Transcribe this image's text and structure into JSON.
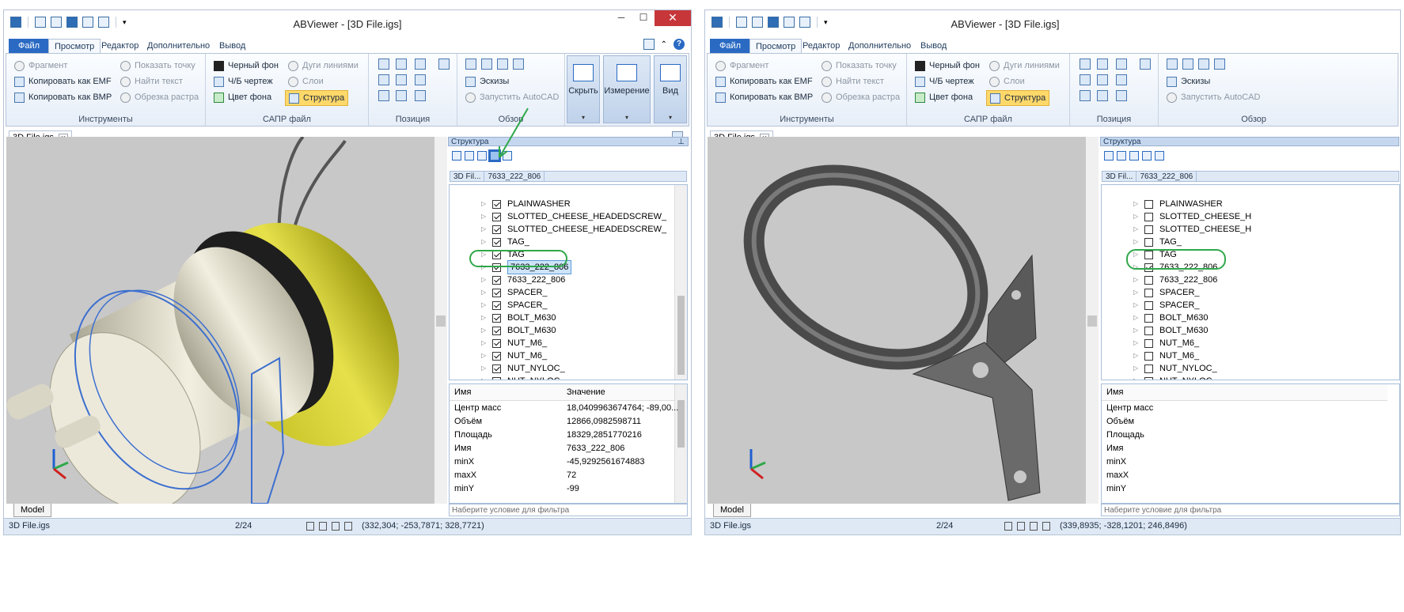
{
  "windows": [
    {
      "title": "ABViewer - [3D File.igs]",
      "tabs": {
        "file": "Файл",
        "view": "Просмотр",
        "editor": "Редактор",
        "advanced": "Дополнительно",
        "output": "Вывод"
      },
      "ribbon": {
        "tools": {
          "title": "Инструменты",
          "fragment": "Фрагмент",
          "copy_emf": "Копировать как EMF",
          "copy_bmp": "Копировать как BMP",
          "show_point": "Показать точку",
          "find_text": "Найти текст",
          "crop_raster": "Обрезка растра"
        },
        "cad": {
          "title": "САПР файл",
          "black_bg": "Черный фон",
          "bw_drawing": "Ч/Б чертеж",
          "bg_color": "Цвет фона",
          "arcs_lines": "Дуги линиями",
          "layers": "Слои",
          "structure": "Структура"
        },
        "position": {
          "title": "Позиция"
        },
        "overview": {
          "title": "Обзор",
          "sketches": "Эскизы",
          "run_autocad": "Запустить AutoCAD"
        },
        "hide": "Скрыть",
        "measure": "Измерение",
        "view": "Вид"
      },
      "doc_tab": "3D File.igs",
      "panel": {
        "header": "Структура",
        "breadcrumb": [
          "3D Fil...",
          "7633_222_806"
        ],
        "tree": [
          {
            "label": "PLAINWASHER",
            "checked": true
          },
          {
            "label": "SLOTTED_CHEESE_HEADEDSCREW_",
            "checked": true
          },
          {
            "label": "SLOTTED_CHEESE_HEADEDSCREW_",
            "checked": true
          },
          {
            "label": "TAG_",
            "checked": true
          },
          {
            "label": "TAG",
            "checked": true
          },
          {
            "label": "7633_222_806",
            "checked": true,
            "selected": true
          },
          {
            "label": "7633_222_806",
            "checked": true
          },
          {
            "label": "SPACER_",
            "checked": true
          },
          {
            "label": "SPACER_",
            "checked": true
          },
          {
            "label": "BOLT_M630",
            "checked": true
          },
          {
            "label": "BOLT_M630",
            "checked": true
          },
          {
            "label": "NUT_M6_",
            "checked": true
          },
          {
            "label": "NUT_M6_",
            "checked": true
          },
          {
            "label": "NUT_NYLOC_",
            "checked": true
          },
          {
            "label": "NUT_NYLOC_",
            "checked": true
          }
        ],
        "props_header": {
          "name": "Имя",
          "value": "Значение"
        },
        "props": [
          {
            "k": "Центр масс",
            "v": "18,0409963674764; -89,00..."
          },
          {
            "k": "Объём",
            "v": "12866,0982598711"
          },
          {
            "k": "Площадь",
            "v": "18329,2851770216"
          },
          {
            "k": "Имя",
            "v": "7633_222_806"
          },
          {
            "k": "minX",
            "v": "-45,9292561674883"
          },
          {
            "k": "maxX",
            "v": "72"
          },
          {
            "k": "minY",
            "v": "-99"
          }
        ],
        "filter_placeholder": "Наберите условие для фильтра"
      },
      "model_tab": "Model",
      "status": {
        "file": "3D File.igs",
        "page": "2/24",
        "coords": "(332,304; -253,7871; 328,7721)"
      }
    },
    {
      "title": "ABViewer - [3D File.igs]",
      "tabs": {
        "file": "Файл",
        "view": "Просмотр",
        "editor": "Редактор",
        "advanced": "Дополнительно",
        "output": "Вывод"
      },
      "ribbon": {
        "tools": {
          "title": "Инструменты",
          "fragment": "Фрагмент",
          "copy_emf": "Копировать как EMF",
          "copy_bmp": "Копировать как BMP",
          "show_point": "Показать точку",
          "find_text": "Найти текст",
          "crop_raster": "Обрезка растра"
        },
        "cad": {
          "title": "САПР файл",
          "black_bg": "Черный фон",
          "bw_drawing": "Ч/Б чертеж",
          "bg_color": "Цвет фона",
          "arcs_lines": "Дуги линиями",
          "layers": "Слои",
          "structure": "Структура"
        },
        "position": {
          "title": "Позиция"
        },
        "overview": {
          "title": "Обзор",
          "sketches": "Эскизы",
          "run_autocad": "Запустить AutoCAD"
        }
      },
      "doc_tab": "3D File.igs",
      "panel": {
        "header": "Структура",
        "breadcrumb": [
          "3D Fil...",
          "7633_222_806"
        ],
        "tree": [
          {
            "label": "PLAINWASHER",
            "checked": false
          },
          {
            "label": "SLOTTED_CHEESE_H",
            "checked": false
          },
          {
            "label": "SLOTTED_CHEESE_H",
            "checked": false
          },
          {
            "label": "TAG_",
            "checked": false
          },
          {
            "label": "TAG",
            "checked": false
          },
          {
            "label": "7633_222_806",
            "checked": true
          },
          {
            "label": "7633_222_806",
            "checked": false
          },
          {
            "label": "SPACER_",
            "checked": false
          },
          {
            "label": "SPACER_",
            "checked": false
          },
          {
            "label": "BOLT_M630",
            "checked": false
          },
          {
            "label": "BOLT_M630",
            "checked": false
          },
          {
            "label": "NUT_M6_",
            "checked": false
          },
          {
            "label": "NUT_M6_",
            "checked": false
          },
          {
            "label": "NUT_NYLOC_",
            "checked": false
          },
          {
            "label": "NUT_NYLOC_",
            "checked": false
          }
        ],
        "props_header": {
          "name": "Имя"
        },
        "props": [
          {
            "k": "Центр масс"
          },
          {
            "k": "Объём"
          },
          {
            "k": "Площадь"
          },
          {
            "k": "Имя"
          },
          {
            "k": "minX"
          },
          {
            "k": "maxX"
          },
          {
            "k": "minY"
          }
        ],
        "filter_placeholder": "Наберите условие для фильтра"
      },
      "model_tab": "Model",
      "status": {
        "file": "3D File.igs",
        "page": "2/24",
        "coords": "(339,8935; -328,1201; 246,8496)"
      }
    }
  ],
  "colors": {
    "accent": "#2a6ac3",
    "highlight_annotation": "#2fa84a",
    "structure_active": "#ffd86a",
    "close_button": "#c7373a"
  }
}
